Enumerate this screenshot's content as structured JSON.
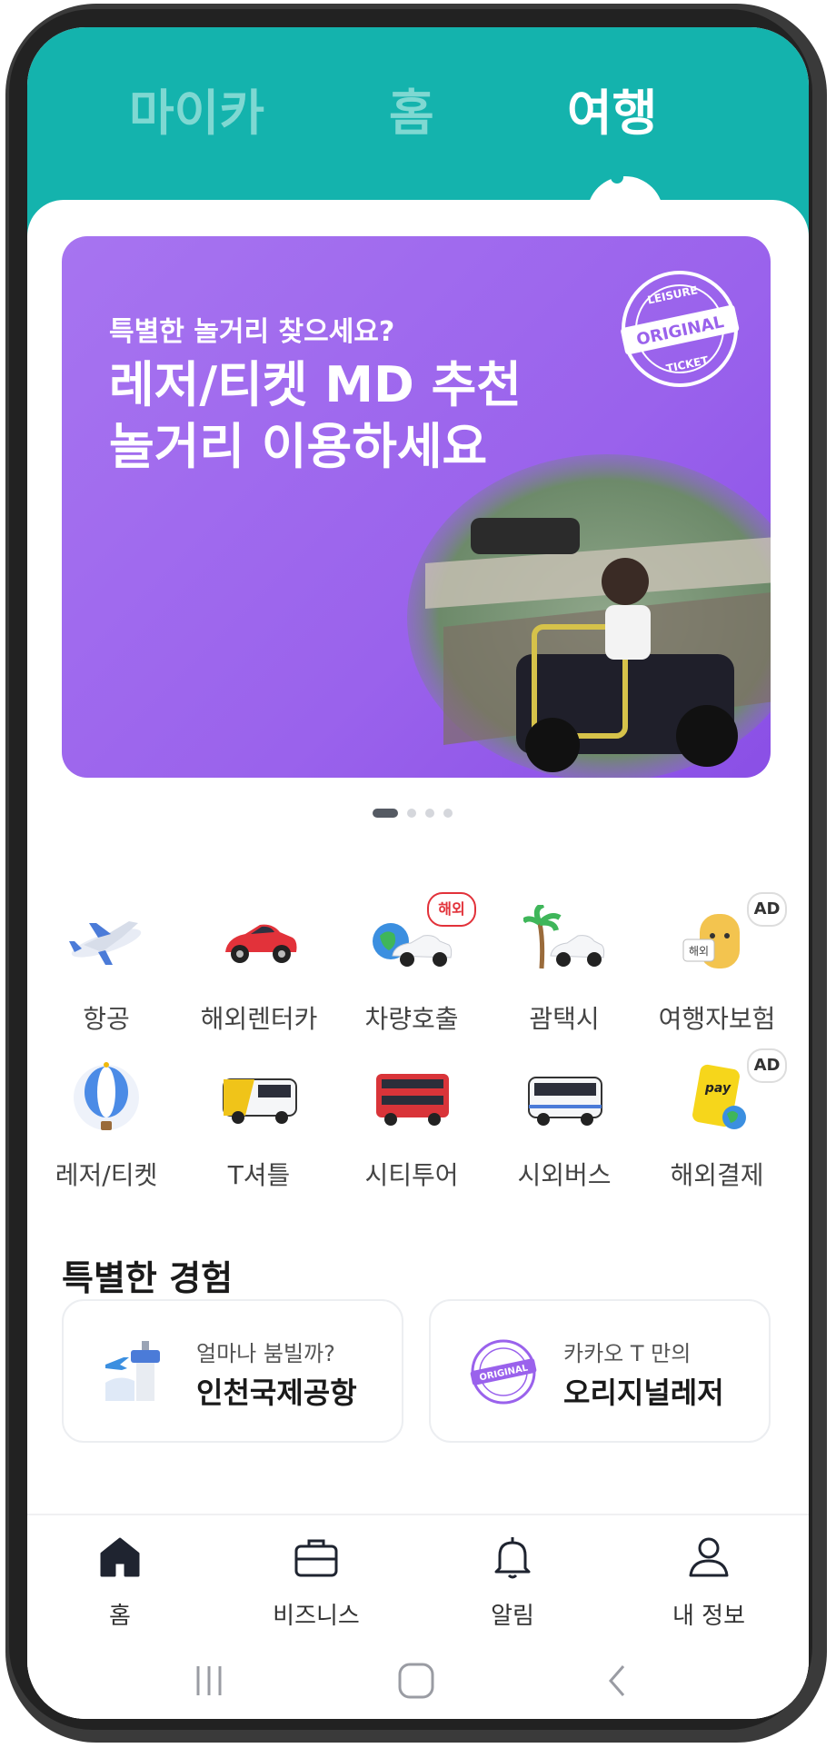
{
  "tabs": [
    {
      "label": "마이카"
    },
    {
      "label": "홈"
    },
    {
      "label": "여행"
    }
  ],
  "banner": {
    "subtitle": "특별한 놀거리 찾으세요?",
    "title_line1": "레저/티켓 MD 추천",
    "title_line2": "놀거리 이용하세요",
    "stamp_top": "LEISURE",
    "stamp_main": "ORIGINAL",
    "stamp_bottom": "TICKET"
  },
  "carousel": {
    "pages": 4,
    "current": 1
  },
  "services_row1": [
    {
      "label": "항공",
      "icon": "airplane-icon"
    },
    {
      "label": "해외렌터카",
      "icon": "red-car-icon"
    },
    {
      "label": "차량호출",
      "icon": "globe-car-icon",
      "badge": "해외"
    },
    {
      "label": "괌택시",
      "icon": "palm-taxi-icon"
    },
    {
      "label": "여행자보험",
      "icon": "insurance-character-icon",
      "badge": "AD",
      "badge_text": "해외"
    }
  ],
  "services_row2": [
    {
      "label": "레저/티켓",
      "icon": "hot-air-balloon-icon"
    },
    {
      "label": "T셔틀",
      "icon": "shuttle-bus-icon"
    },
    {
      "label": "시티투어",
      "icon": "double-decker-bus-icon"
    },
    {
      "label": "시외버스",
      "icon": "intercity-bus-icon"
    },
    {
      "label": "해외결제",
      "icon": "pay-card-icon",
      "badge": "AD",
      "badge_text": "pay"
    }
  ],
  "special": {
    "title": "특별한 경험",
    "cards": [
      {
        "subtitle": "얼마나 붐빌까?",
        "title": "인천국제공항",
        "icon": "airport-tower-icon"
      },
      {
        "subtitle": "카카오 T 만의",
        "title": "오리지널레저",
        "icon": "original-stamp-icon"
      }
    ]
  },
  "bottom_nav": [
    {
      "label": "홈",
      "icon": "home-icon",
      "active": true
    },
    {
      "label": "비즈니스",
      "icon": "briefcase-icon"
    },
    {
      "label": "알림",
      "icon": "bell-icon"
    },
    {
      "label": "내 정보",
      "icon": "person-icon"
    }
  ],
  "colors": {
    "brand": "#14b3ad",
    "banner": "#9a62ec"
  }
}
